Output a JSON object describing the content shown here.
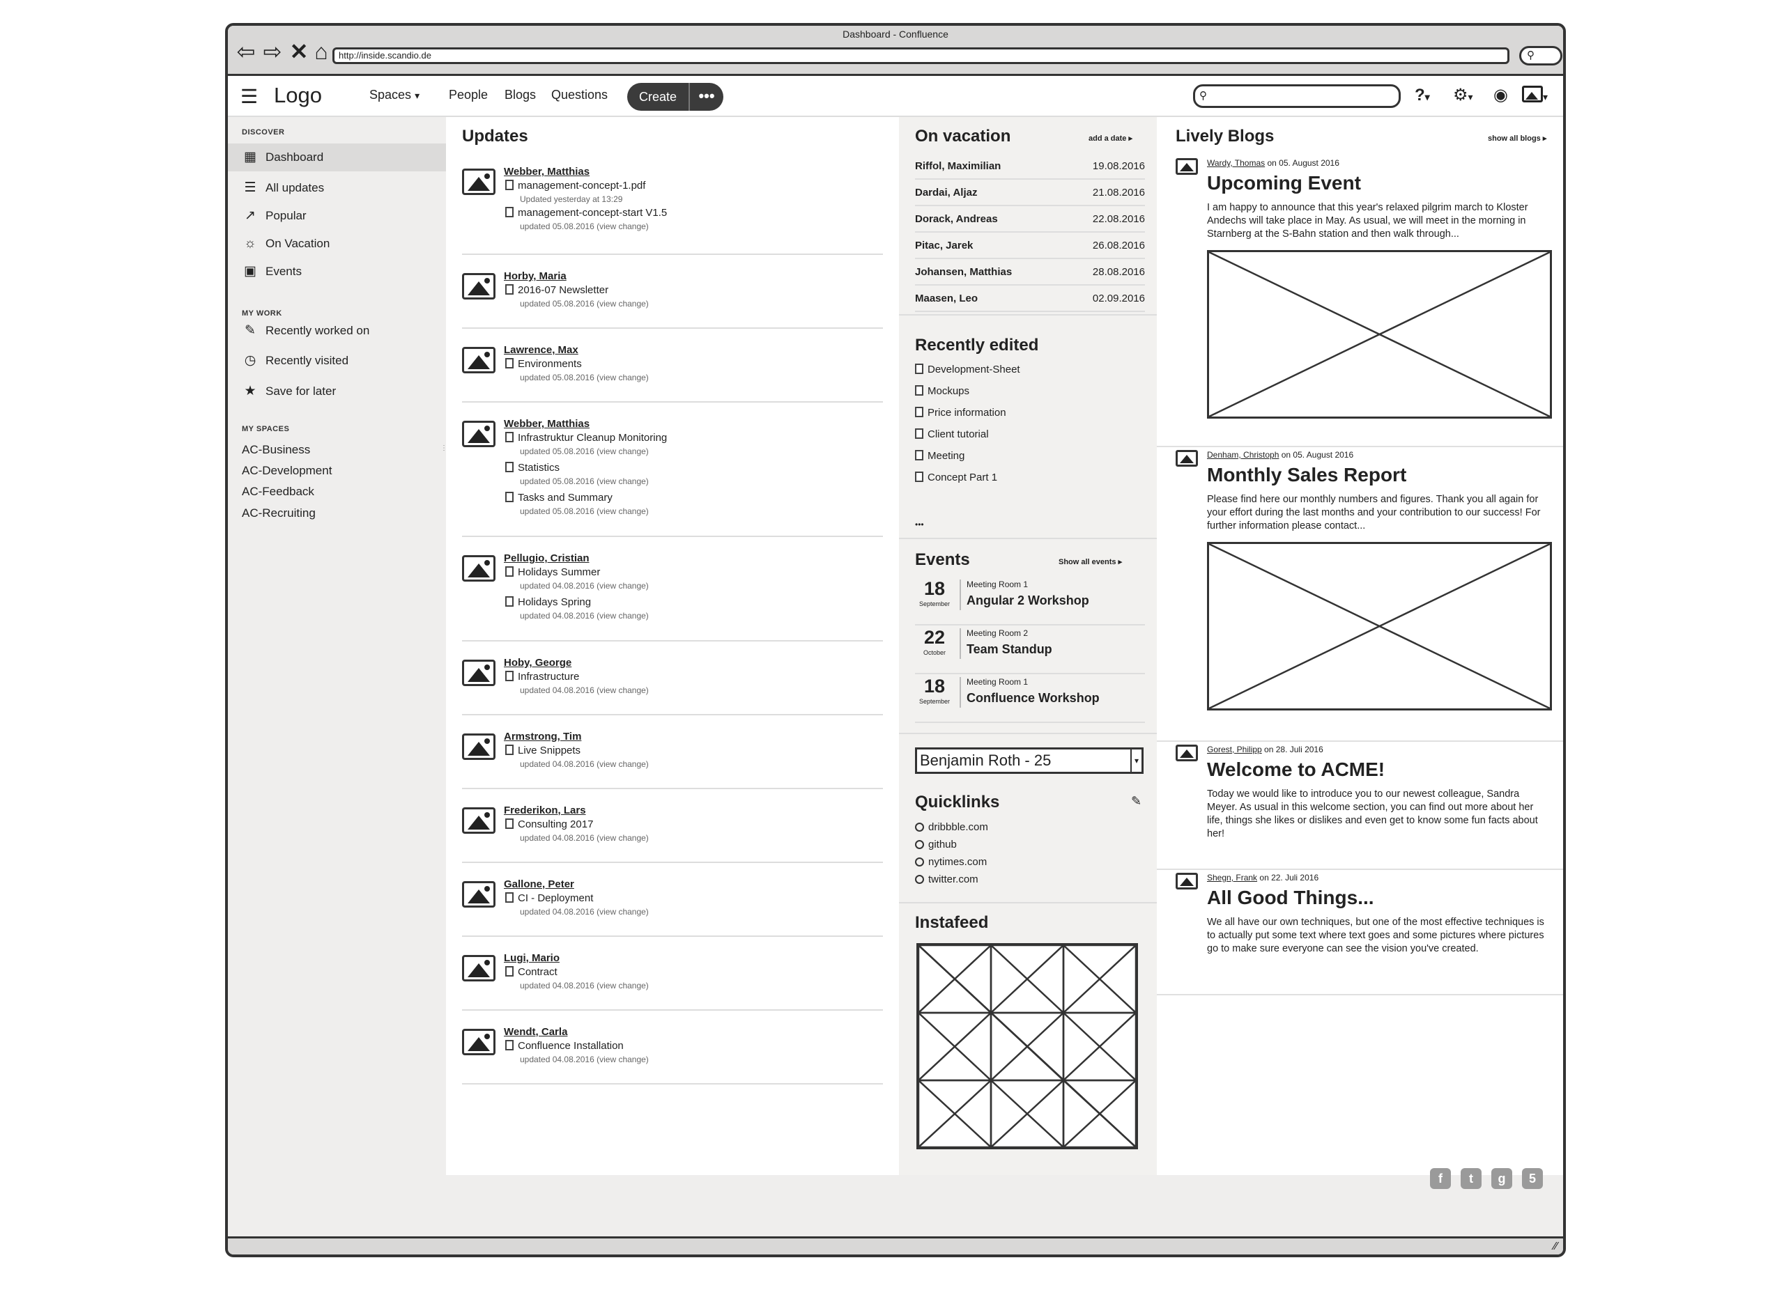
{
  "window": {
    "title": "Dashboard - Confluence",
    "url": "http://inside.scandio.de"
  },
  "topnav": {
    "logo": "Logo",
    "links": [
      "Spaces",
      "People",
      "Blogs",
      "Questions"
    ],
    "spaces_caret": "▾",
    "create": "Create",
    "more": "•••",
    "help": "?",
    "caret": "▾"
  },
  "sidebar": {
    "discover_heading": "DISCOVER",
    "discover": [
      {
        "label": "Dashboard",
        "icon": "dashboard-icon"
      },
      {
        "label": "All updates",
        "icon": "list-icon"
      },
      {
        "label": "Popular",
        "icon": "chart-icon"
      },
      {
        "label": "On Vacation",
        "icon": "sun-icon"
      },
      {
        "label": "Events",
        "icon": "calendar-icon"
      }
    ],
    "mywork_heading": "MY WORK",
    "mywork": [
      {
        "label": "Recently worked on",
        "icon": "pencil-icon"
      },
      {
        "label": "Recently visited",
        "icon": "clock-icon"
      },
      {
        "label": "Save for later",
        "icon": "star-icon"
      }
    ],
    "myspaces_heading": "MY SPACES",
    "myspaces": [
      "AC-Business",
      "AC-Development",
      "AC-Feedback",
      "AC-Recruiting"
    ]
  },
  "updates": {
    "title": "Updates",
    "items": [
      {
        "author": "Webber, Matthias",
        "docs": [
          {
            "name": "management-concept-1.pdf",
            "meta": "Updated yesterday at 13:29"
          },
          {
            "name": "management-concept-start V1.5",
            "meta": "updated 05.08.2016 (view change)"
          }
        ]
      },
      {
        "author": "Horby, Maria",
        "docs": [
          {
            "name": "2016-07 Newsletter",
            "meta": "updated 05.08.2016 (view change)"
          }
        ]
      },
      {
        "author": "Lawrence, Max",
        "docs": [
          {
            "name": "Environments",
            "meta": "updated 05.08.2016 (view change)"
          }
        ]
      },
      {
        "author": "Webber, Matthias",
        "docs": [
          {
            "name": "Infrastruktur Cleanup Monitoring",
            "meta": "updated 05.08.2016 (view change)"
          },
          {
            "name": "Statistics",
            "meta": "updated 05.08.2016 (view change)"
          },
          {
            "name": "Tasks and Summary",
            "meta": "updated 05.08.2016 (view change)"
          }
        ]
      },
      {
        "author": "Pellugio, Cristian",
        "docs": [
          {
            "name": "Holidays Summer",
            "meta": "updated 04.08.2016 (view change)"
          },
          {
            "name": "Holidays Spring",
            "meta": "updated 04.08.2016 (view change)"
          }
        ]
      },
      {
        "author": "Hoby, George",
        "docs": [
          {
            "name": "Infrastructure",
            "meta": "updated 04.08.2016 (view change)"
          }
        ]
      },
      {
        "author": "Armstrong, Tim",
        "docs": [
          {
            "name": "Live Snippets",
            "meta": "updated 04.08.2016 (view change)"
          }
        ]
      },
      {
        "author": "Frederikon, Lars",
        "docs": [
          {
            "name": "Consulting 2017",
            "meta": "updated 04.08.2016 (view change)"
          }
        ]
      },
      {
        "author": "Gallone, Peter",
        "docs": [
          {
            "name": "CI - Deployment",
            "meta": "updated 04.08.2016 (view change)"
          }
        ]
      },
      {
        "author": "Lugi, Mario",
        "docs": [
          {
            "name": "Contract",
            "meta": "updated 04.08.2016 (view change)"
          }
        ]
      },
      {
        "author": "Wendt, Carla",
        "docs": [
          {
            "name": "Confluence Installation",
            "meta": "updated 04.08.2016 (view change)"
          }
        ]
      }
    ]
  },
  "vacation": {
    "title": "On vacation",
    "action": "add a date",
    "rows": [
      {
        "name": "Riffol, Maximilian",
        "date": "19.08.2016"
      },
      {
        "name": "Dardai, Aljaz",
        "date": "21.08.2016"
      },
      {
        "name": "Dorack, Andreas",
        "date": "22.08.2016"
      },
      {
        "name": "Pitac, Jarek",
        "date": "26.08.2016"
      },
      {
        "name": "Johansen, Matthias",
        "date": "28.08.2016"
      },
      {
        "name": "Maasen, Leo",
        "date": "02.09.2016"
      }
    ]
  },
  "recent": {
    "title": "Recently edited",
    "items": [
      "Development-Sheet",
      "Mockups",
      "Price information",
      "Client tutorial",
      "Meeting",
      "Concept Part 1"
    ],
    "more": "•••"
  },
  "events": {
    "title": "Events",
    "action": "Show all events",
    "items": [
      {
        "day": "18",
        "month": "September",
        "room": "Meeting Room 1",
        "name": "Angular 2 Workshop"
      },
      {
        "day": "22",
        "month": "October",
        "room": "Meeting Room 2",
        "name": "Team Standup"
      },
      {
        "day": "18",
        "month": "September",
        "room": "Meeting Room 1",
        "name": "Confluence Workshop"
      }
    ]
  },
  "select": {
    "value": "Benjamin Roth - 25",
    "arrow": "▾"
  },
  "quicklinks": {
    "title": "Quicklinks",
    "items": [
      "dribbble.com",
      "github",
      "nytimes.com",
      "twitter.com"
    ]
  },
  "instafeed": {
    "title": "Instafeed"
  },
  "blogs": {
    "title": "Lively Blogs",
    "action": "show all blogs",
    "posts": [
      {
        "author": "Wardy, Thomas",
        "date": "on 05. August 2016",
        "title": "Upcoming Event",
        "text": "I am happy to announce that this year's relaxed pilgrim march to Kloster Andechs will take place in May. As usual, we will meet in the morning in Starnberg at the S-Bahn station and then walk through..."
      },
      {
        "author": "Denham, Christoph",
        "date": "on 05. August 2016",
        "title": "Monthly Sales Report",
        "text": "Please find here our monthly numbers and figures. Thank you all again for your effort during the last months and your contribution to our success! For further information please contact..."
      },
      {
        "author": "Gorest, Philipp",
        "date": "on 28. Juli 2016",
        "title": "Welcome to ACME!",
        "text": "Today we would like to introduce you to our newest colleague, Sandra Meyer. As usual in this welcome section, you can find out more about her life, things she likes or dislikes and even get to know some fun facts about her!"
      },
      {
        "author": "Shegn, Frank",
        "date": "on 22. Juli 2016",
        "title": "All Good Things...",
        "text": "We all have our own techniques, but one of the most effective techniques is to actually put some text where text goes and some pictures where pictures go to make sure everyone can see the vision you've created."
      }
    ]
  },
  "footer": {
    "icons": [
      "facebook-icon",
      "twitter-icon",
      "github-icon",
      "html5-icon"
    ],
    "glyphs": [
      "f",
      "t",
      "g",
      "5"
    ]
  }
}
